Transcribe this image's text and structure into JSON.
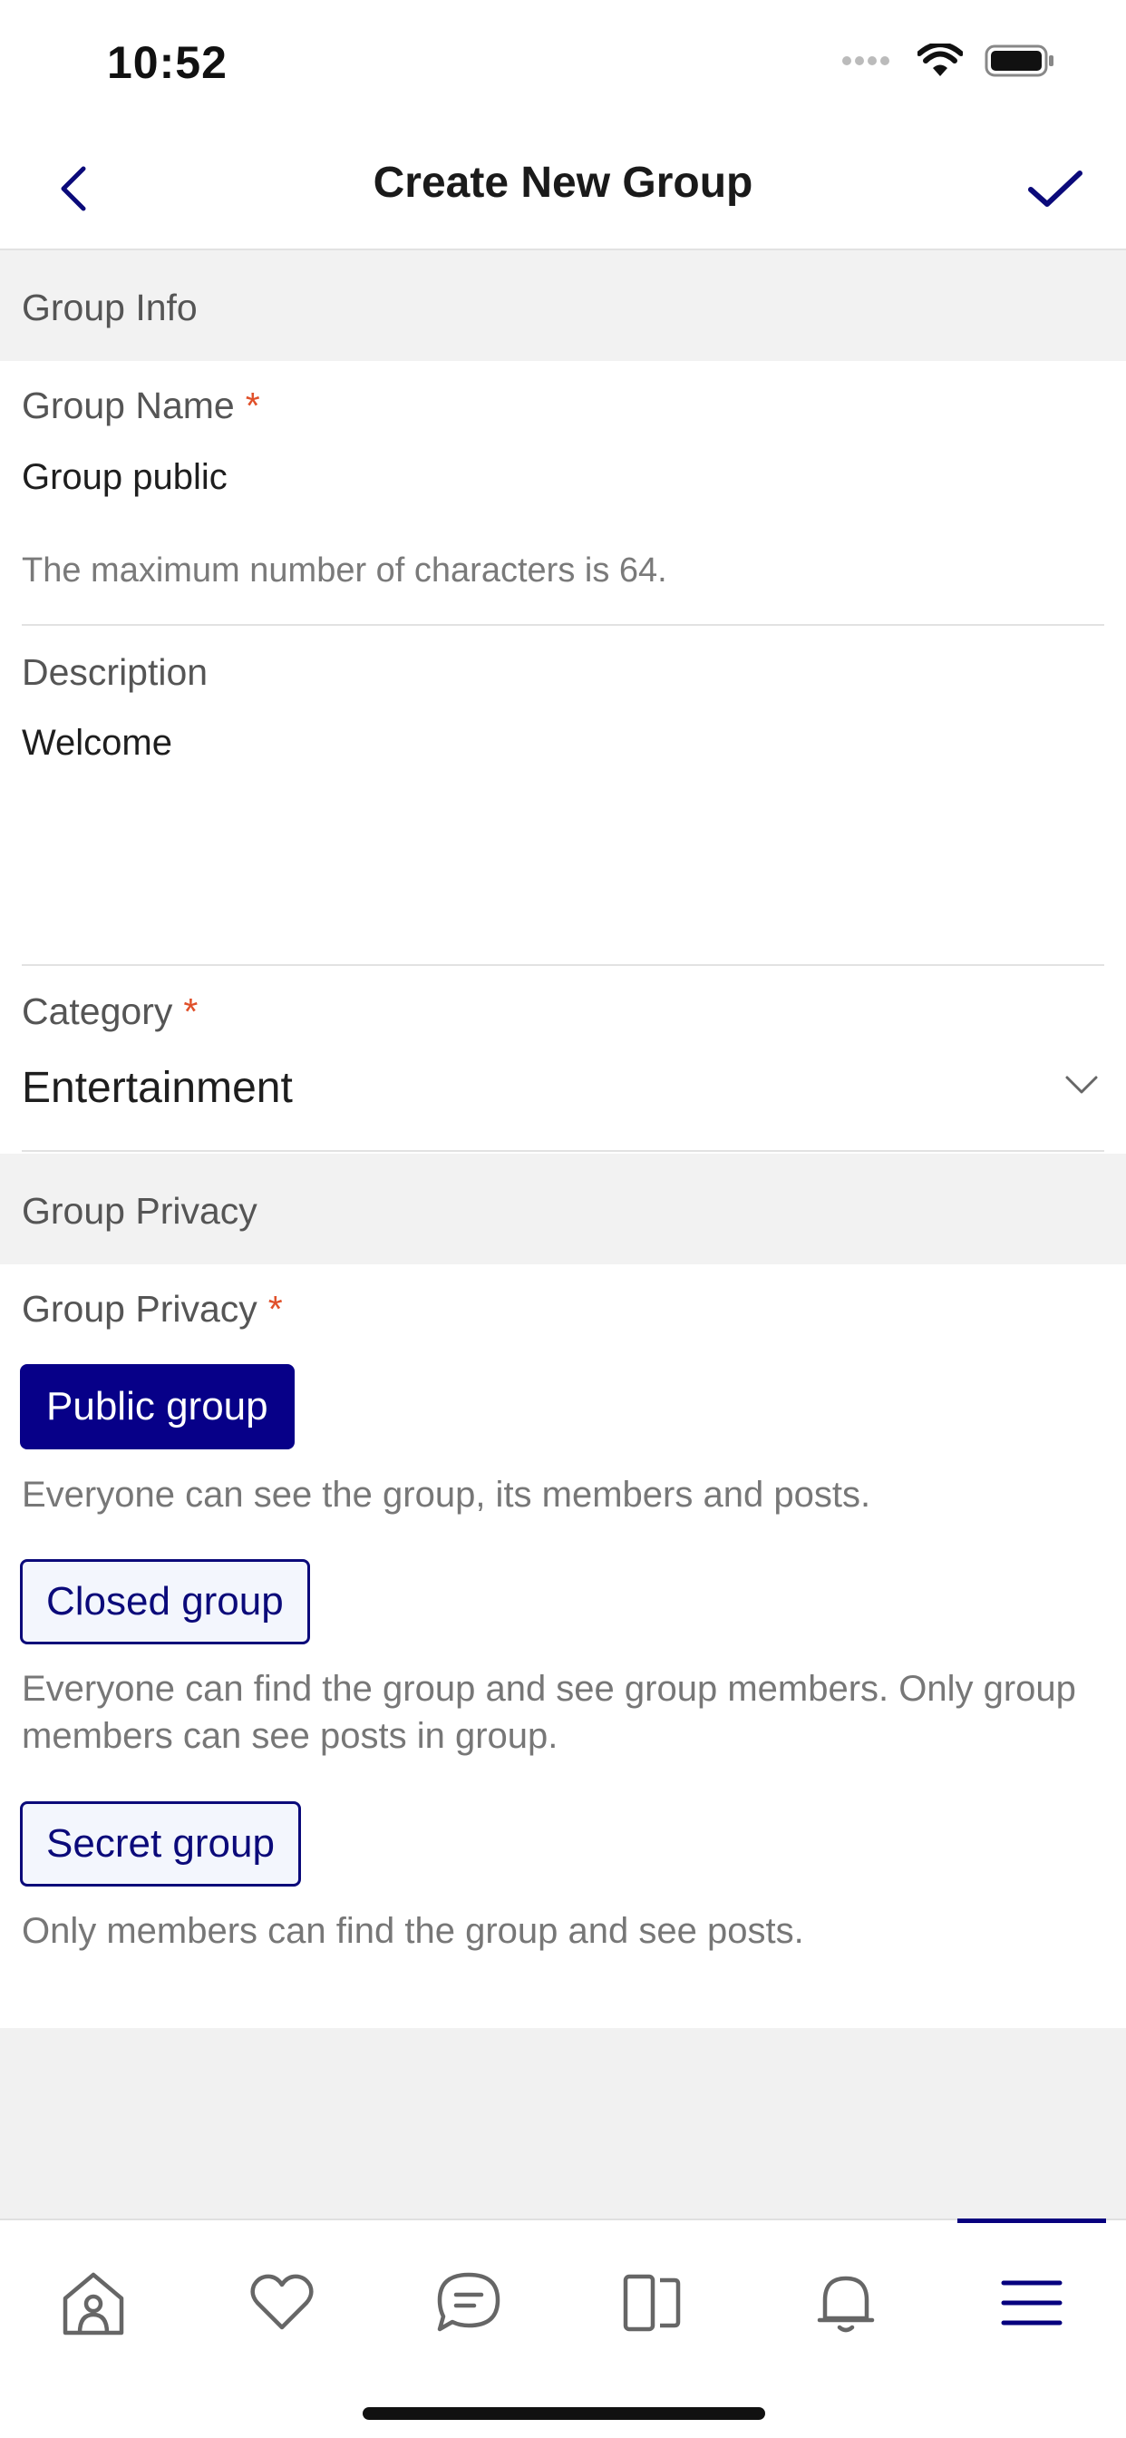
{
  "status_bar": {
    "time": "10:52"
  },
  "nav": {
    "title": "Create New Group"
  },
  "group_info": {
    "section_title": "Group Info",
    "name_label": "Group Name",
    "required_mark": "*",
    "name_value": "Group public",
    "name_hint": "The maximum number of characters is 64.",
    "description_label": "Description",
    "description_value": "Welcome",
    "category_label": "Category",
    "category_value": "Entertainment"
  },
  "group_privacy": {
    "section_title": "Group Privacy",
    "field_label": "Group Privacy",
    "options": [
      {
        "label": "Public group",
        "description": "Everyone can see the group, its members and posts.",
        "selected": true
      },
      {
        "label": "Closed group",
        "description": "Everyone can find the group and see group members. Only group members can see posts in group.",
        "selected": false
      },
      {
        "label": "Secret group",
        "description": "Only members can find the group and see posts.",
        "selected": false
      }
    ]
  },
  "tab_bar": {
    "items": [
      "home-icon",
      "heart-icon",
      "chat-icon",
      "pages-icon",
      "bell-icon",
      "menu-icon"
    ],
    "active_index": 5
  },
  "colors": {
    "accent": "#070088",
    "required": "#e0502a",
    "section_bg": "#f2f2f2"
  }
}
